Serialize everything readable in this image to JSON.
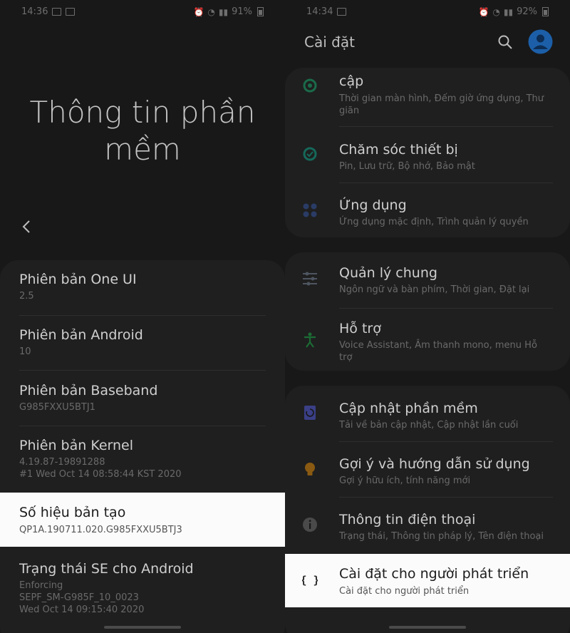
{
  "left": {
    "status": {
      "time": "14:36",
      "battery": "91%"
    },
    "title": "Thông tin phần mềm",
    "items": [
      {
        "title": "Phiên bản One UI",
        "subtitle": "2.5"
      },
      {
        "title": "Phiên bản Android",
        "subtitle": "10"
      },
      {
        "title": "Phiên bản Baseband",
        "subtitle": "G985FXXU5BTJ1"
      },
      {
        "title": "Phiên bản Kernel",
        "subtitle": "4.19.87-19891288",
        "subtitle2": "#1 Wed Oct 14 08:58:44 KST 2020"
      },
      {
        "title": "Số hiệu bản tạo",
        "subtitle": "QP1A.190711.020.G985FXXU5BTJ3"
      },
      {
        "title": "Trạng thái SE cho Android",
        "subtitle": "Enforcing",
        "subtitle2": "SEPF_SM-G985F_10_0023",
        "subtitle3": "Wed Oct 14 09:15:40 2020"
      }
    ]
  },
  "right": {
    "status": {
      "time": "14:34",
      "battery": "92%"
    },
    "header": "Cài đặt",
    "items": [
      {
        "title": "cập",
        "subtitle": "Thời gian màn hình, Đếm giờ ứng dụng, Thư",
        "subtitle2": "giãn",
        "icon": "digital-wellbeing-icon"
      },
      {
        "title": "Chăm sóc thiết bị",
        "subtitle": "Pin, Lưu trữ, Bộ nhớ, Bảo mật",
        "icon": "device-care-icon"
      },
      {
        "title": "Ứng dụng",
        "subtitle": "Ứng dụng mặc định, Trình quản lý quyền",
        "icon": "apps-icon"
      },
      {
        "title": "Quản lý chung",
        "subtitle": "Ngôn ngữ và bàn phím, Thời gian, Đặt lại",
        "icon": "sliders-icon"
      },
      {
        "title": "Hỗ trợ",
        "subtitle": "Voice Assistant, Âm thanh mono, menu Hỗ",
        "subtitle2": "trợ",
        "icon": "accessibility-icon"
      },
      {
        "title": "Cập nhật phần mềm",
        "subtitle": "Tải về bản cập nhật, Cập nhật lần cuối",
        "icon": "software-update-icon"
      },
      {
        "title": "Gợi ý và hướng dẫn sử dụng",
        "subtitle": "Gợi ý hữu ích, tính năng mới",
        "icon": "lightbulb-icon"
      },
      {
        "title": "Thông tin điện thoại",
        "subtitle": "Trạng thái, Thông tin pháp lý, Tên điện thoại",
        "icon": "info-icon"
      },
      {
        "title": "Cài đặt cho người phát triển",
        "subtitle": "Cài đặt cho người phát triển",
        "icon": "developer-braces-icon"
      }
    ]
  }
}
